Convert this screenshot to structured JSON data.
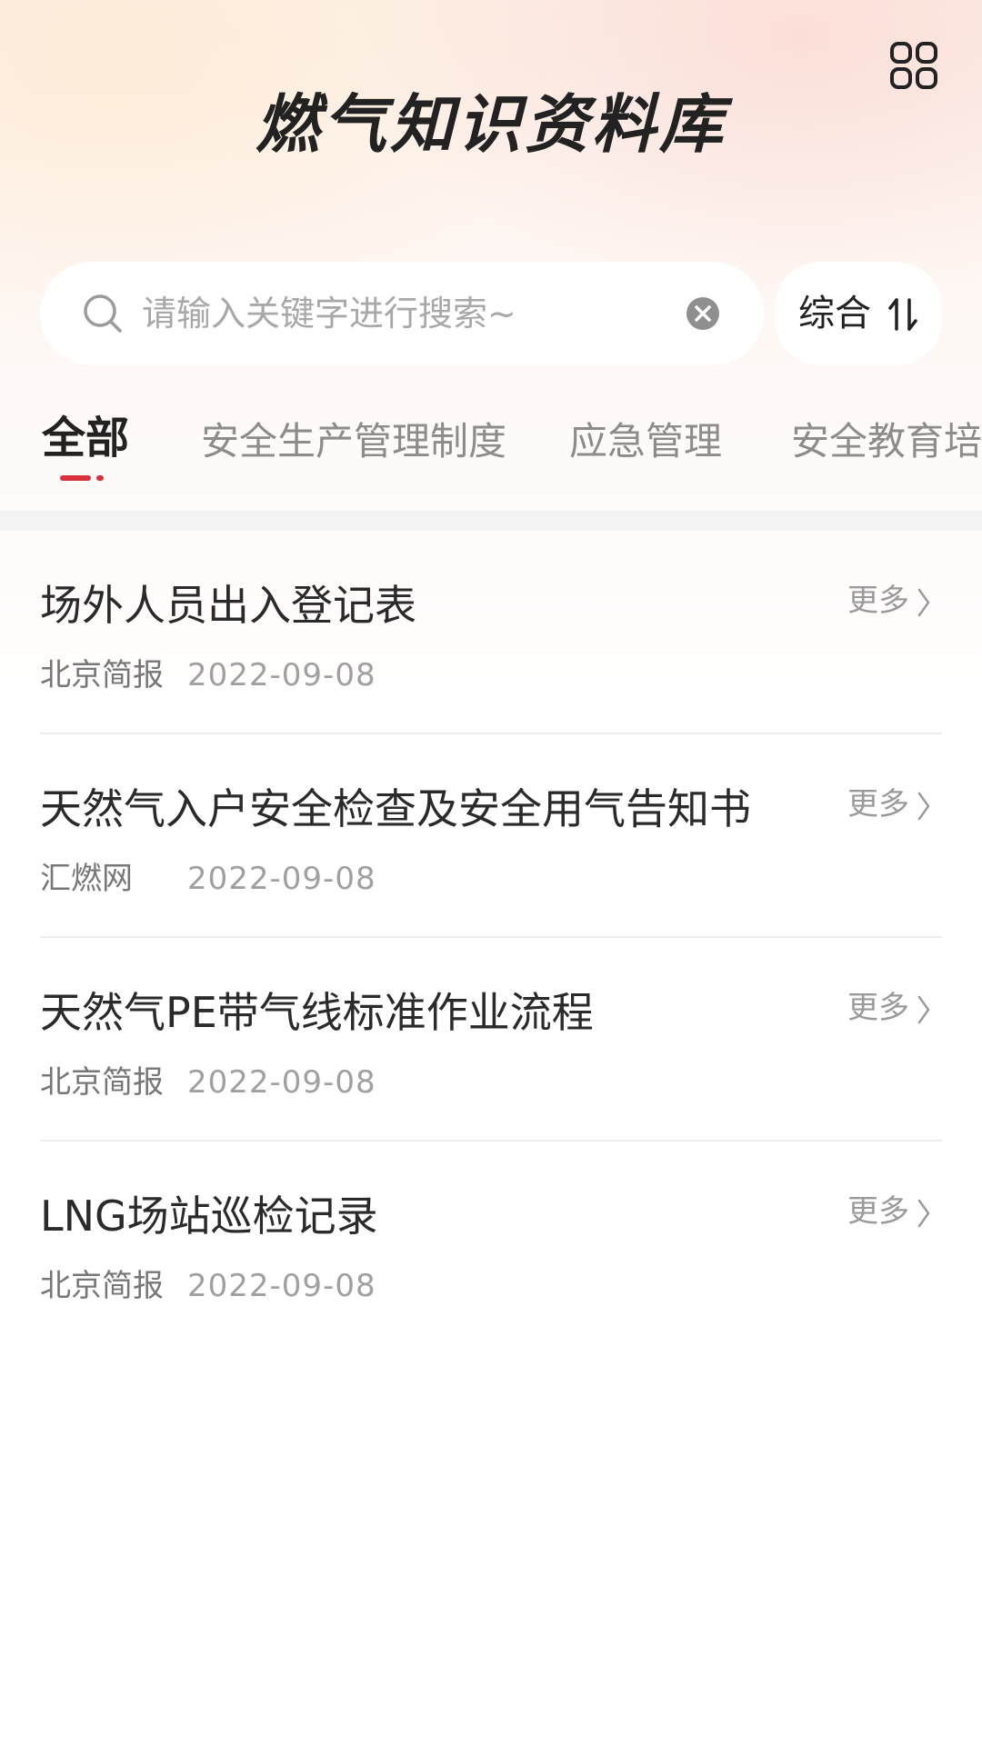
{
  "header": {
    "title": "燃气知识资料库"
  },
  "search": {
    "placeholder": "请输入关键字进行搜索~",
    "value": ""
  },
  "sort": {
    "label": "综合"
  },
  "tabs": [
    {
      "label": "全部",
      "active": true
    },
    {
      "label": "安全生产管理制度",
      "active": false
    },
    {
      "label": "应急管理",
      "active": false
    },
    {
      "label": "安全教育培训",
      "active": false
    }
  ],
  "items": [
    {
      "title": "场外人员出入登记表",
      "source": "北京简报",
      "date": "2022-09-08",
      "more": "更多"
    },
    {
      "title": "天然气入户安全检查及安全用气告知书",
      "source": "汇燃网",
      "date": "2022-09-08",
      "more": "更多"
    },
    {
      "title": "天然气PE带气线标准作业流程",
      "source": "北京简报",
      "date": "2022-09-08",
      "more": "更多"
    },
    {
      "title": "LNG场站巡检记录",
      "source": "北京简报",
      "date": "2022-09-08",
      "more": "更多"
    }
  ],
  "colors": {
    "accent": "#d9303e",
    "title_text": "#222222",
    "muted_text": "#9a9a9a"
  },
  "icons": {
    "menu": "grid-icon",
    "search": "search-icon",
    "clear": "clear-icon",
    "sort": "sort-icon",
    "more": "chevron-right-icon"
  }
}
